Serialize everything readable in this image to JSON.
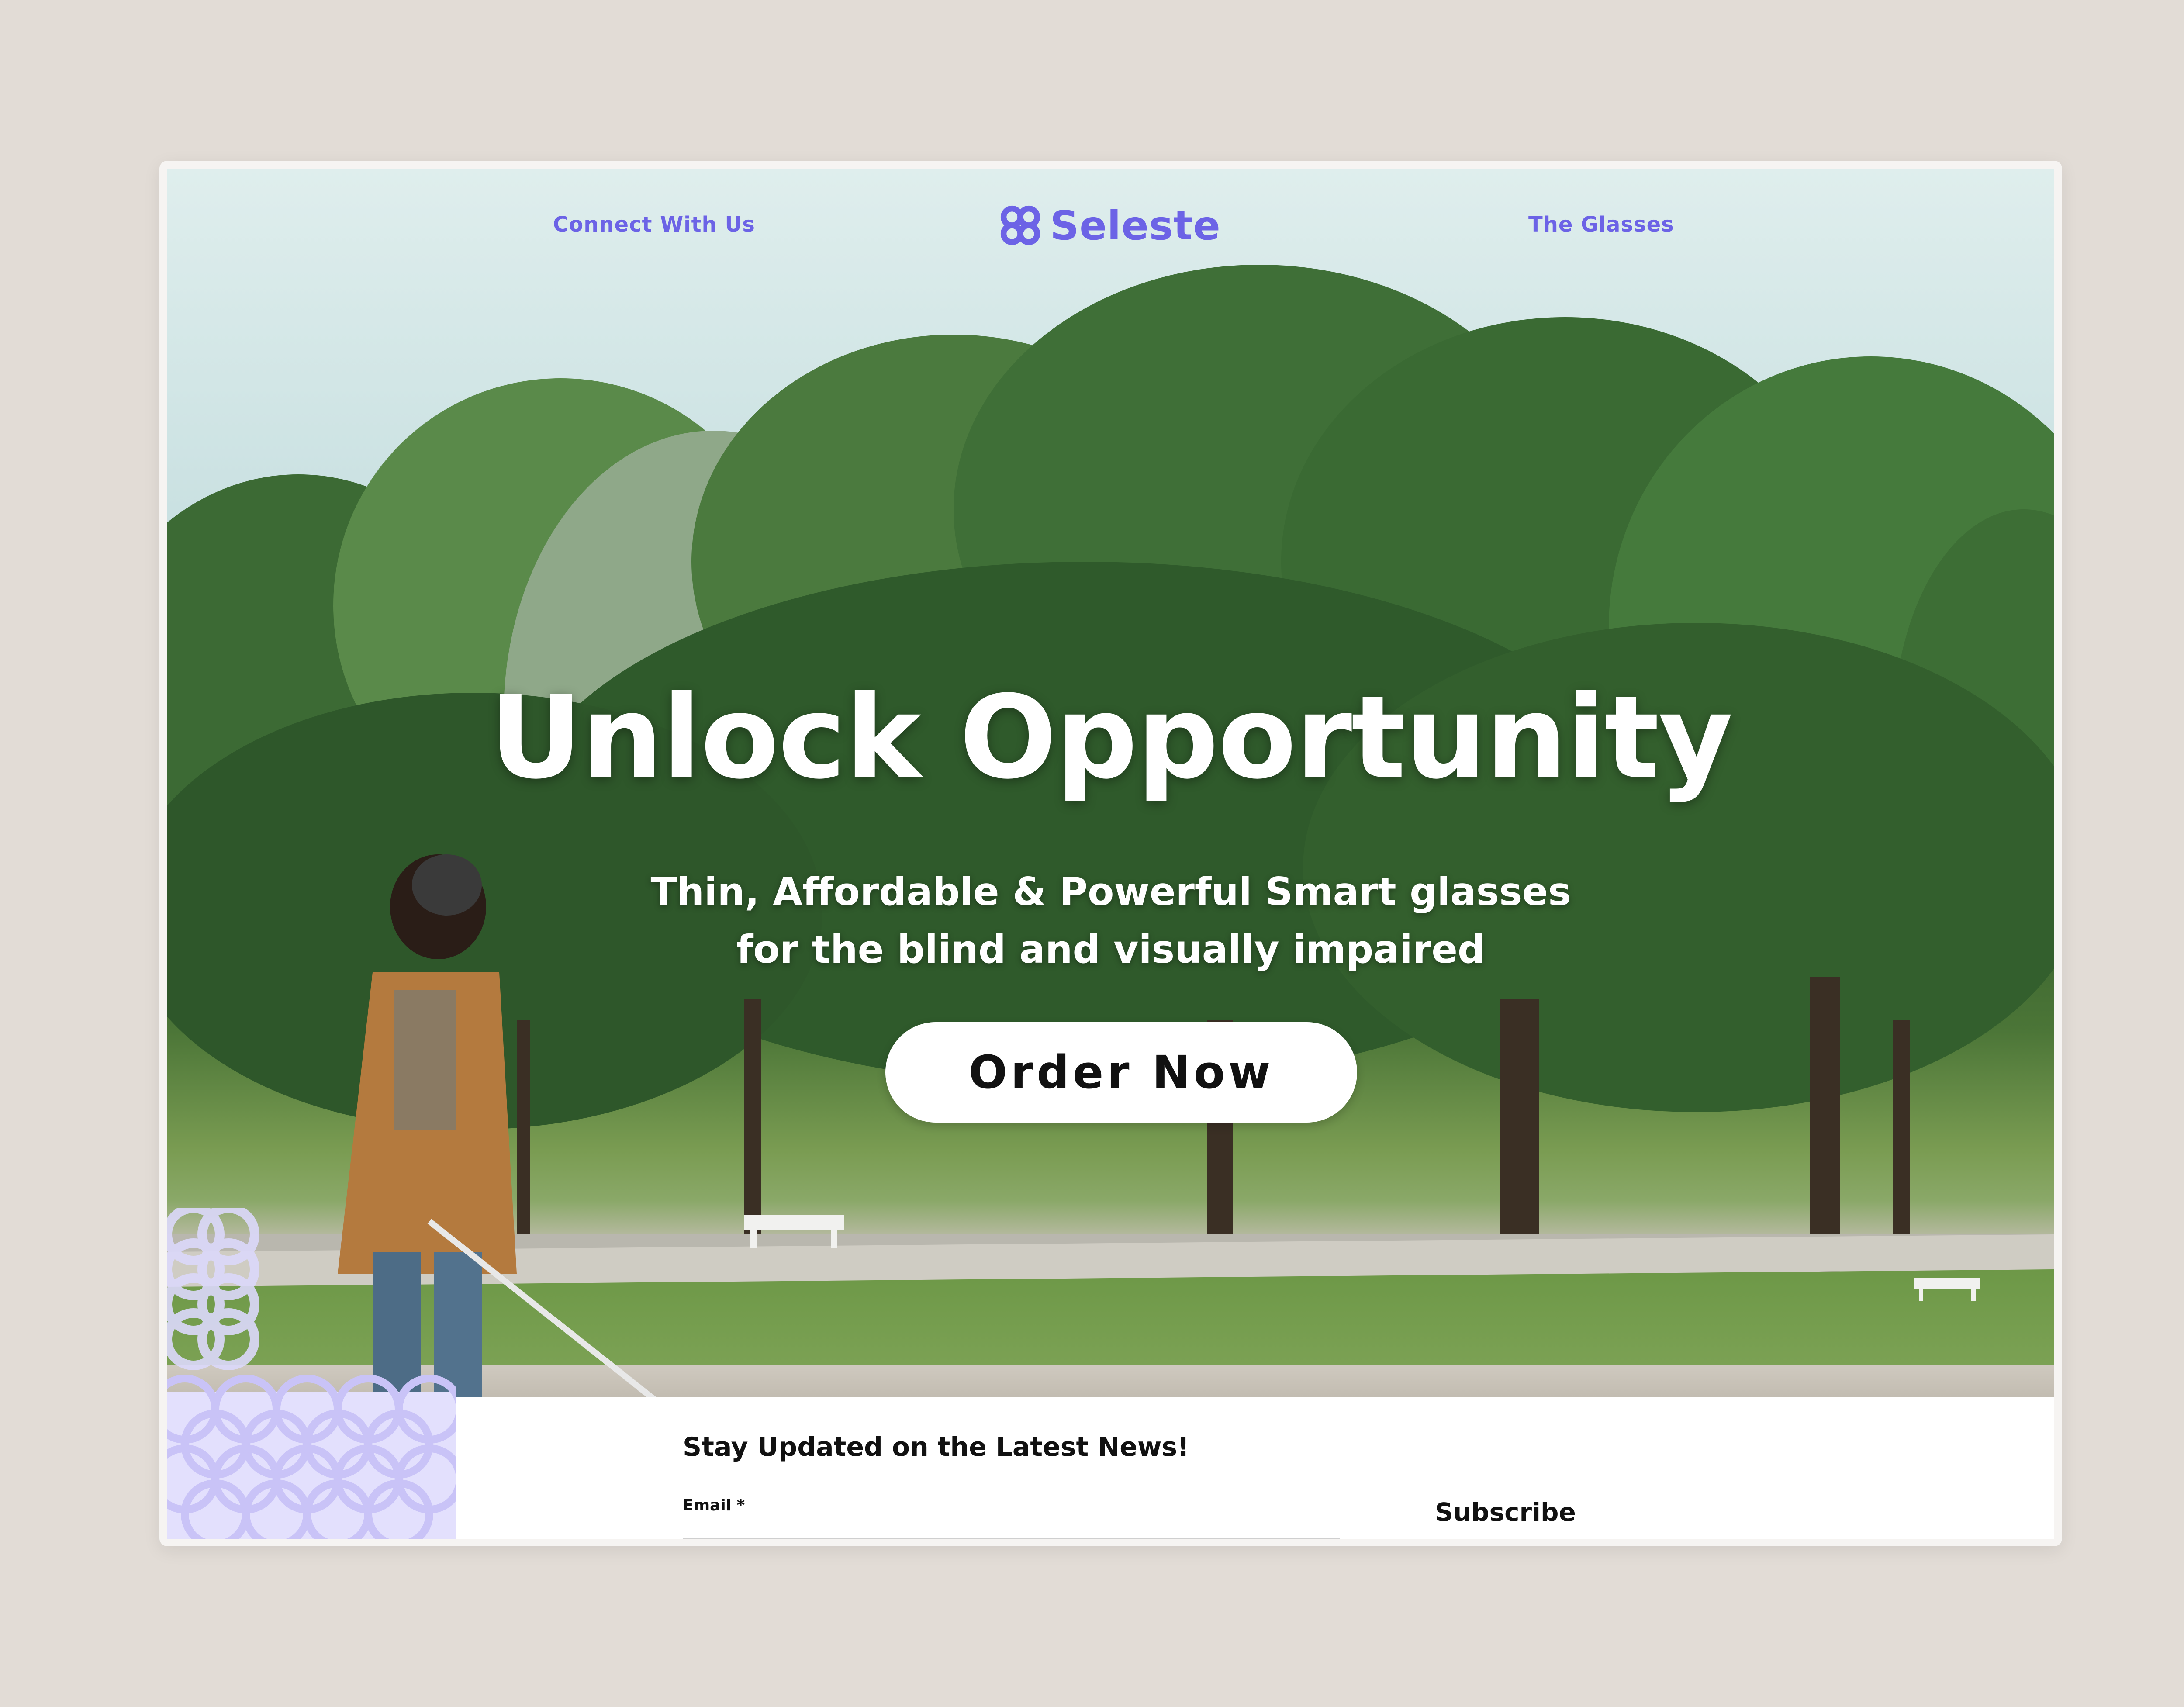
{
  "nav": {
    "left_link": "Connect With Us",
    "brand_name": "Seleste",
    "right_link": "The Glasses"
  },
  "hero": {
    "headline": "Unlock Opportunity",
    "subline_line1": "Thin, Affordable & Powerful Smart glasses",
    "subline_line2": "for the blind and visually impaired",
    "cta_label": "Order Now"
  },
  "newsletter": {
    "title": "Stay Updated on the Latest News!",
    "email_label": "Email *",
    "email_value": "",
    "subscribe_label": "Subscribe"
  },
  "colors": {
    "brand": "#6c63e6",
    "pattern": "#dcd9fb",
    "page_background": "#e2dcd6"
  },
  "icons": {
    "logo": "four-circle-lattice-logo-icon"
  }
}
